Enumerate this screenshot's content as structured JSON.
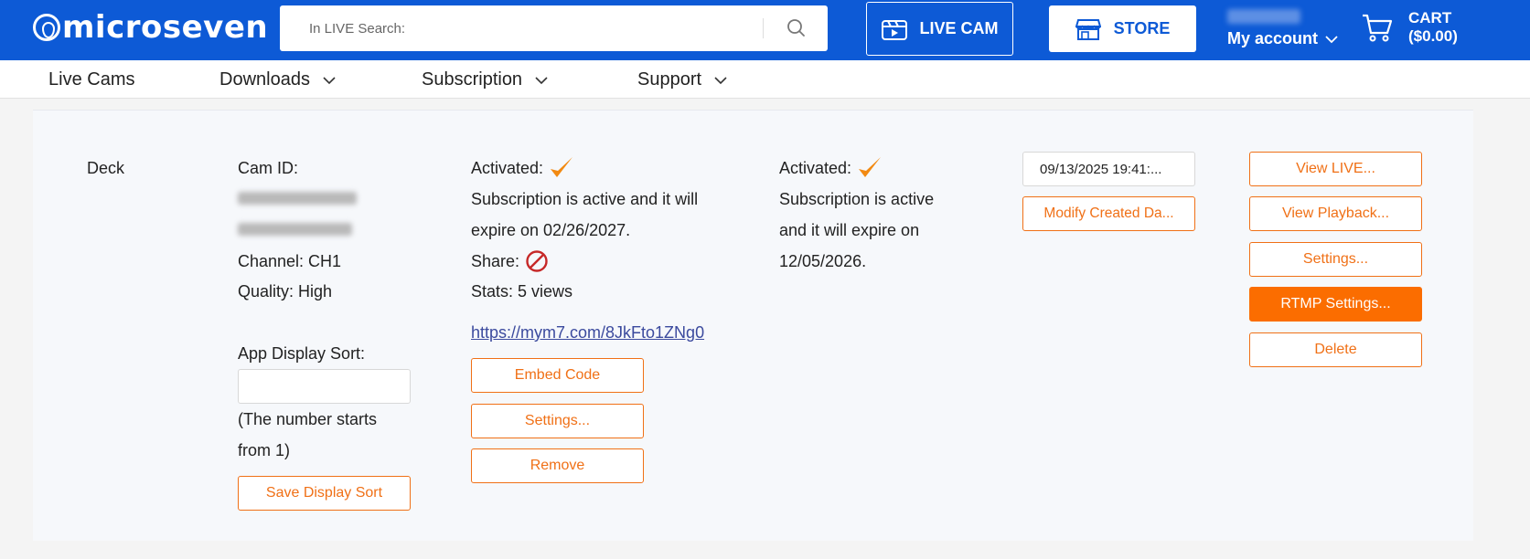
{
  "header": {
    "logo_text": "microseven",
    "search_placeholder": "In LIVE Search:",
    "live_cam_label": "LIVE CAM",
    "store_label": "STORE",
    "account_label": "My account",
    "cart_label": "CART",
    "cart_total": "($0.00)"
  },
  "nav": {
    "items": [
      {
        "label": "Live Cams"
      },
      {
        "label": "Downloads"
      },
      {
        "label": "Subscription"
      },
      {
        "label": "Support"
      }
    ]
  },
  "camera": {
    "name": "Deck",
    "cam_id_label": "Cam ID:",
    "channel": "Channel: CH1",
    "quality": "Quality: High",
    "sort_label": "App Display Sort:",
    "sort_value": "",
    "sort_hint_line1": "(The number starts",
    "sort_hint_line2": "from 1)",
    "save_sort_label": "Save Display Sort"
  },
  "live_subscription": {
    "activated_label": "Activated:",
    "status_line1": "Subscription is active and it will",
    "status_line2": "expire on 02/26/2027.",
    "share_label": "Share:",
    "stats": "Stats: 5 views",
    "share_link": "https://mym7.com/8JkFto1ZNg0",
    "embed_code_label": "Embed Code",
    "settings_label": "Settings...",
    "remove_label": "Remove"
  },
  "cloud_subscription": {
    "activated_label": "Activated:",
    "status_line1": "Subscription is active",
    "status_line2": "and it will expire on",
    "status_line3": "12/05/2026."
  },
  "created": {
    "date": "09/13/2025 19:41:...",
    "modify_label": "Modify Created Da..."
  },
  "actions": {
    "view_live": "View LIVE...",
    "view_playback": "View Playback...",
    "settings": "Settings...",
    "rtmp_settings": "RTMP Settings...",
    "delete": "Delete"
  },
  "colors": {
    "brand_blue": "#0d5ad6",
    "accent_orange": "#f07016",
    "check_orange": "#f28a12",
    "forbidden_red": "#c62828"
  }
}
